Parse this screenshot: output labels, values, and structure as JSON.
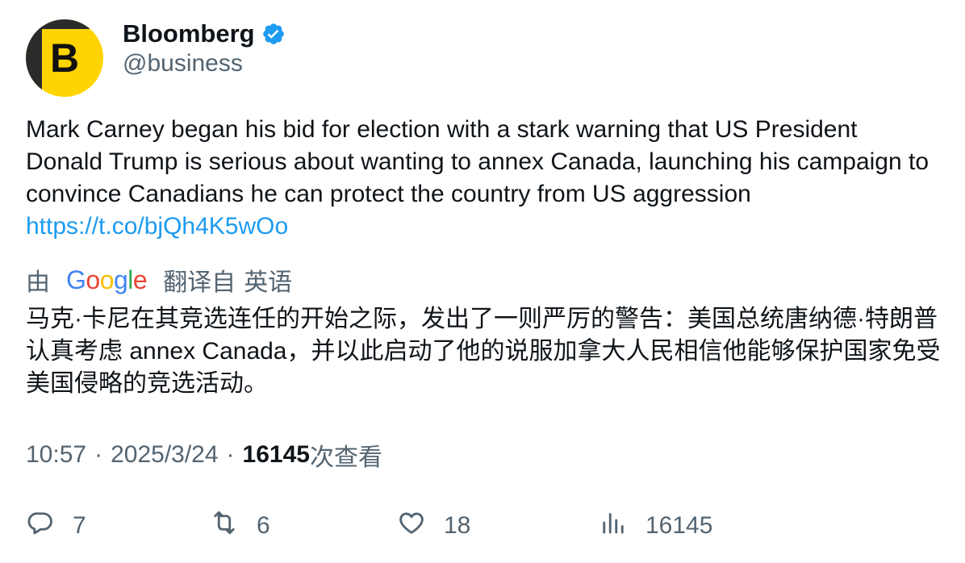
{
  "author": {
    "display_name": "Bloomberg",
    "handle": "@business",
    "avatar_letter": "B",
    "verified": true,
    "avatar_color": "#ffd400"
  },
  "tweet": {
    "text": "Mark Carney began his bid for election with a stark warning that US President Donald Trump is serious about wanting to annex Canada, launching his campaign to convince Canadians he can protect the country from US aggression ",
    "link": "https://t.co/bjQh4K5wOo",
    "link_color": "#1d9bf0"
  },
  "translation": {
    "by_label": "由",
    "provider": "Google",
    "translated_from_label": "翻译自",
    "source_language": "英语",
    "text": "马克·卡尼在其竞选连任的开始之际，发出了一则严厉的警告：美国总统唐纳德·特朗普认真考虑 annex Canada，并以此启动了他的说服加拿大人民相信他能够保护国家免受美国侵略的竞选活动。"
  },
  "meta": {
    "time": "10:57",
    "separator": "·",
    "date": "2025/3/24",
    "views": "16145",
    "views_label": "次查看"
  },
  "actions": {
    "replies": "7",
    "retweets": "6",
    "likes": "18",
    "views": "16145",
    "icons": [
      "reply-icon",
      "retweet-icon",
      "like-icon",
      "views-icon"
    ]
  }
}
